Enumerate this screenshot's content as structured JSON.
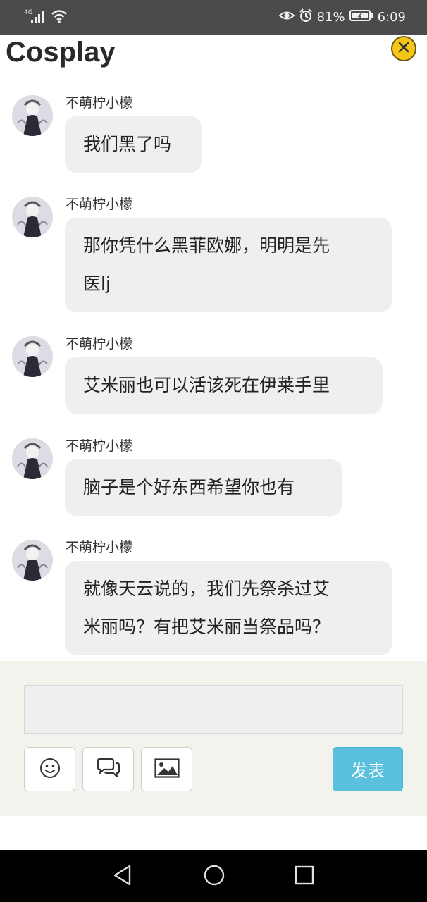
{
  "status_bar": {
    "network": "4G",
    "battery_percent": "81%",
    "time": "6:09"
  },
  "page": {
    "title": "Cosplay"
  },
  "messages": [
    {
      "sender": "不萌柠小檬",
      "lines": [
        "我们黑了吗"
      ]
    },
    {
      "sender": "不萌柠小檬",
      "lines": [
        "那你凭什么黑菲欧娜，明明是先",
        "医lj"
      ]
    },
    {
      "sender": "不萌柠小檬",
      "lines": [
        "艾米丽也可以活该死在伊莱手里"
      ]
    },
    {
      "sender": "不萌柠小檬",
      "lines": [
        "脑子是个好东西希望你也有"
      ]
    },
    {
      "sender": "不萌柠小檬",
      "lines": [
        "就像天云说的，我们先祭杀过艾",
        "米丽吗？有把艾米丽当祭品吗？"
      ]
    }
  ],
  "compose": {
    "input_value": "",
    "send_label": "发表"
  },
  "icons": {
    "close": "close-icon",
    "emoji": "smiley-icon",
    "quote": "chat-bubbles-icon",
    "image": "image-icon"
  }
}
